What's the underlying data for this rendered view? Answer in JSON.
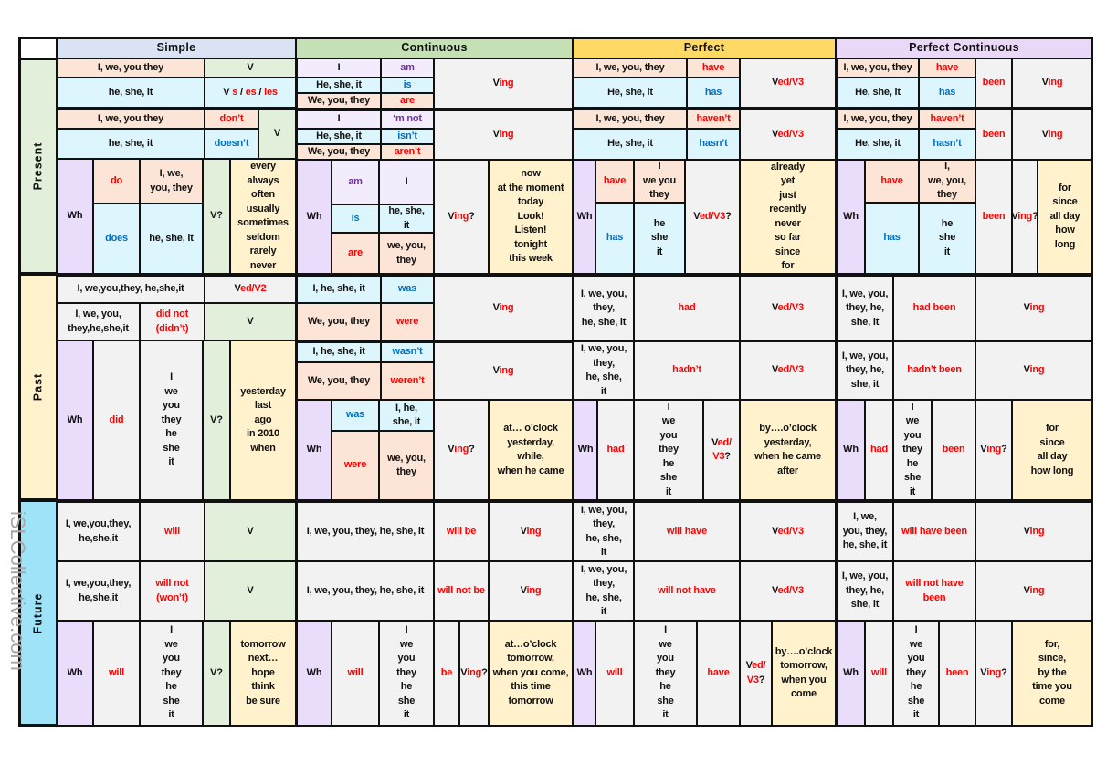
{
  "header": {
    "simple": "Simple",
    "continuous": "Continuous",
    "perfect": "Perfect",
    "perfect_continuous": "Perfect Continuous"
  },
  "tenses": {
    "present": "Present",
    "past": "Past",
    "future": "Future"
  },
  "watermark": "iSLCollective.com",
  "colors": {
    "red": "#ff0000",
    "blue": "#0070c0",
    "purple": "#7030a0",
    "simple_header": "#dae3f3",
    "continuous_header": "#c5e0b4",
    "perfect_header": "#ffd966",
    "perfect_continuous_header": "#ead8f8"
  },
  "ps": {
    "a1": "I, we, you they",
    "a2": "V",
    "a3": "he, she, it",
    "a4": [
      [
        "V ",
        ""
      ],
      [
        "s",
        "r"
      ],
      [
        " / ",
        ""
      ],
      [
        "es",
        "r"
      ],
      [
        " / ",
        ""
      ],
      [
        "ies",
        "r"
      ]
    ],
    "n1": "I, we, you they",
    "n2": "don’t",
    "n3": "he, she, it",
    "n4": "doesn’t",
    "n5": "V",
    "q1": "Wh",
    "q2": "do",
    "q3": "I, we,\nyou, they",
    "q4": "does",
    "q5": "he, she, it",
    "q6": "V?",
    "q7": "every\nalways\noften\nusually\nsometimes\nseldom\nrarely\nnever"
  },
  "pc": {
    "a1": "I",
    "a2": "am",
    "a3": "He, she, it",
    "a4": "is",
    "a5": "We, you, they",
    "a6": "are",
    "a7": [
      [
        "V",
        ""
      ],
      [
        "ing",
        "r"
      ]
    ],
    "n1": "I",
    "n2": "‘m not",
    "n3": "He, she, it",
    "n4": "isn’t",
    "n5": "We, you, they",
    "n6": "aren’t",
    "n7": [
      [
        "V",
        ""
      ],
      [
        "ing",
        "r"
      ]
    ],
    "q1": "Wh",
    "q2": "am",
    "q3": "I",
    "q4": "is",
    "q5": "he, she,\nit",
    "q6": "are",
    "q7": "we, you,\nthey",
    "q8": [
      [
        "V",
        ""
      ],
      [
        "ing",
        "r"
      ],
      [
        "?",
        ""
      ]
    ],
    "q9": "now\nat the moment\ntoday\nLook!\nListen!\ntonight\nthis week"
  },
  "pp": {
    "a1": "I, we, you, they",
    "a2": "have",
    "a3": "He, she, it",
    "a4": "has",
    "a5": [
      [
        "V",
        ""
      ],
      [
        "ed/V3",
        "r"
      ]
    ],
    "n1": "I, we, you, they",
    "n2": "haven’t",
    "n3": "He, she, it",
    "n4": "hasn’t",
    "n5": [
      [
        "V",
        ""
      ],
      [
        "ed/V3",
        "r"
      ]
    ],
    "q1": "Wh",
    "q2": "have",
    "q3": "I\nwe you\nthey",
    "q4": "has",
    "q5": "he\nshe\nit",
    "q6": [
      [
        "V",
        ""
      ],
      [
        "ed/V3",
        "r"
      ],
      [
        "?",
        ""
      ]
    ],
    "q7": "already\nyet\njust\nrecently\nnever\nso far\nsince\nfor"
  },
  "ppc": {
    "a1": "I, we, you, they",
    "a2": "have",
    "a3": "He, she, it",
    "a4": "has",
    "a5": "been",
    "a6": [
      [
        "V",
        ""
      ],
      [
        "ing",
        "r"
      ]
    ],
    "n1": "I, we, you, they",
    "n2": "haven’t",
    "n3": "He, she, it",
    "n4": "hasn’t",
    "n5": "been",
    "n6": [
      [
        "V",
        ""
      ],
      [
        "ing",
        "r"
      ]
    ],
    "q1": "Wh",
    "q2": "have",
    "q3": "I,\nwe, you,\nthey",
    "q4": "has",
    "q5": "he\nshe\nit",
    "q6": "been",
    "q7": [
      [
        "V",
        ""
      ],
      [
        "ing",
        "r"
      ],
      [
        "?",
        ""
      ]
    ],
    "q8": "for\nsince\nall day\nhow\nlong"
  },
  "pas": {
    "a1": "I, we,you,they, he,she,it",
    "a2": [
      [
        "V",
        ""
      ],
      [
        "ed/V2",
        "r"
      ]
    ],
    "n1": "I, we, you,\nthey,he,she,it",
    "n2": "did not\n(didn’t)",
    "n3": "V",
    "q1": "Wh",
    "q2": "did",
    "q3": "I\nwe\nyou\nthey\nhe\nshe\nit",
    "q4": "V?",
    "q5": "yesterday\nlast\nago\nin 2010\nwhen"
  },
  "pac": {
    "a1": "I, he, she, it",
    "a2": "was",
    "a3": "We, you, they",
    "a4": "were",
    "a5": [
      [
        "V",
        ""
      ],
      [
        "ing",
        "r"
      ]
    ],
    "n1": "I, he, she, it",
    "n2": "wasn’t",
    "n3": "We, you, they",
    "n4": "weren’t",
    "n5": [
      [
        "V",
        ""
      ],
      [
        "ing",
        "r"
      ]
    ],
    "q1": "Wh",
    "q2": "was",
    "q3": "I, he,\nshe, it",
    "q4": "were",
    "q5": "we, you,\nthey",
    "q6": [
      [
        "V",
        ""
      ],
      [
        "ing",
        "r"
      ],
      [
        "?",
        ""
      ]
    ],
    "q7": "at… o’clock\nyesterday,\nwhile,\nwhen he came"
  },
  "pap": {
    "a1": "I, we, you,\nthey,\nhe, she, it",
    "a2": "had",
    "a3": [
      [
        "V",
        ""
      ],
      [
        "ed/V3",
        "r"
      ]
    ],
    "n1": "I, we, you,\nthey,\nhe, she,\nit",
    "n2": "hadn’t",
    "n3": [
      [
        "V",
        ""
      ],
      [
        "ed/V3",
        "r"
      ]
    ],
    "q1": "Wh",
    "q2": "had",
    "q3": "I\nwe\nyou\nthey\nhe\nshe\nit",
    "q4": [
      [
        "V",
        ""
      ],
      [
        "ed/\nV3",
        "r"
      ],
      [
        "?",
        ""
      ]
    ],
    "q5": "by….o’clock\nyesterday,\nwhen he came\nafter"
  },
  "papc": {
    "a1": "I, we, you,\nthey, he,\nshe, it",
    "a2": "had been",
    "a3": [
      [
        "V",
        ""
      ],
      [
        "ing",
        "r"
      ]
    ],
    "n1": "I, we, you,\nthey, he,\nshe, it",
    "n2": "hadn’t been",
    "n3": [
      [
        "V",
        ""
      ],
      [
        "ing",
        "r"
      ]
    ],
    "q1": "Wh",
    "q2": "had",
    "q3": "I\nwe\nyou\nthey\nhe\nshe\nit",
    "q4": "been",
    "q5": [
      [
        "V",
        ""
      ],
      [
        "ing",
        "r"
      ],
      [
        "?",
        ""
      ]
    ],
    "q6": "for\nsince\nall day\nhow long"
  },
  "fs": {
    "a1": "I, we,you,they,\nhe,she,it",
    "a2": "will",
    "a3": "V",
    "n1": "I, we,you,they,\nhe,she,it",
    "n2": "will not\n(won’t)",
    "n3": "V",
    "q1": "Wh",
    "q2": "will",
    "q3": "I\nwe\nyou\nthey\nhe\nshe\nit",
    "q4": "V?",
    "q5": "tomorrow\nnext…\nhope\nthink\nbe sure"
  },
  "fc": {
    "a1": "I, we, you, they, he, she, it",
    "a2": "will be",
    "a3": [
      [
        "V",
        ""
      ],
      [
        "ing",
        "r"
      ]
    ],
    "n1": "I, we, you, they, he, she, it",
    "n2": "will not be",
    "n3": [
      [
        "V",
        ""
      ],
      [
        "ing",
        "r"
      ]
    ],
    "q1": "Wh",
    "q2": "will",
    "q3": "I\nwe\nyou\nthey\nhe\nshe\nit",
    "q4": "be",
    "q5": [
      [
        "V",
        ""
      ],
      [
        "ing",
        "r"
      ],
      [
        "?",
        ""
      ]
    ],
    "q6": "at…o’clock\ntomorrow,\nwhen you come,\nthis time\ntomorrow"
  },
  "fp": {
    "a1": "I, we, you,\nthey,\nhe, she,\nit",
    "a2": "will have",
    "a3": [
      [
        "V",
        ""
      ],
      [
        "ed/V3",
        "r"
      ]
    ],
    "n1": "I, we, you,\nthey,\nhe, she,\nit",
    "n2": "will not have",
    "n3": [
      [
        "V",
        ""
      ],
      [
        "ed/V3",
        "r"
      ]
    ],
    "q1": "Wh",
    "q2": "will",
    "q3": "I\nwe\nyou\nthey\nhe\nshe\nit",
    "q4": "have",
    "q5": [
      [
        "V",
        ""
      ],
      [
        "ed/\nV3",
        "r"
      ],
      [
        "?",
        ""
      ]
    ],
    "q6": "by….o’clock\ntomorrow,\nwhen you\ncome"
  },
  "fpc": {
    "a1": "I, we,\nyou, they,\nhe, she, it",
    "a2": "will have been",
    "a3": [
      [
        "V",
        ""
      ],
      [
        "ing",
        "r"
      ]
    ],
    "n1": "I, we, you,\nthey, he,\nshe, it",
    "n2": "will not have been",
    "n3": [
      [
        "V",
        ""
      ],
      [
        "ing",
        "r"
      ]
    ],
    "q1": "Wh",
    "q2": "will",
    "q3": "I\nwe\nyou\nthey\nhe\nshe\nit",
    "q4": "been",
    "q5": [
      [
        "V",
        ""
      ],
      [
        "ing",
        "r"
      ],
      [
        "?",
        ""
      ]
    ],
    "q6": "for,\nsince,\nby the\ntime you\ncome"
  }
}
